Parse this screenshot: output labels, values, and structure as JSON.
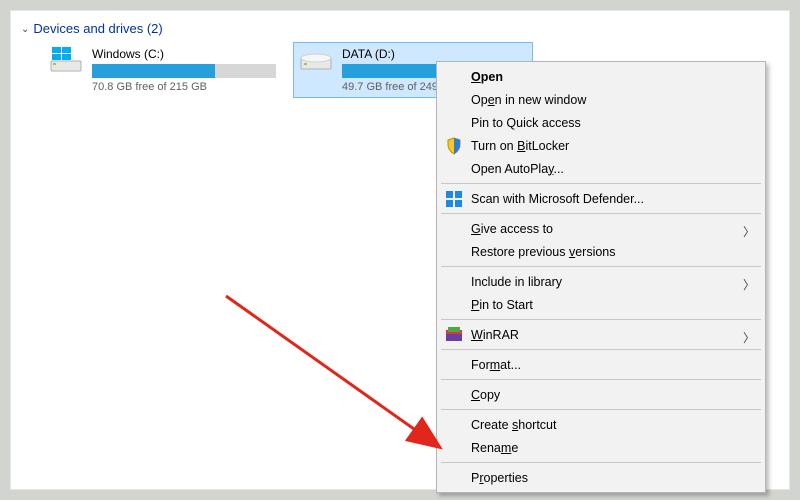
{
  "section": {
    "title": "Devices and drives (2)"
  },
  "drives": [
    {
      "name": "Windows (C:)",
      "free": "70.8 GB free of 215 GB",
      "fill_pct": 67
    },
    {
      "name": "DATA (D:)",
      "free": "49.7 GB free of 249",
      "fill_pct": 80
    }
  ],
  "context_separator_positions": [],
  "ctx": {
    "open": "Open",
    "open_new": "Open in new window",
    "pin_quick": "Pin to Quick access",
    "bitlocker": "Turn on BitLocker",
    "autoplay": "Open AutoPlay...",
    "defender": "Scan with Microsoft Defender...",
    "give_access": "Give access to",
    "restore": "Restore previous versions",
    "include_lib": "Include in library",
    "pin_start": "Pin to Start",
    "winrar": "WinRAR",
    "format": "Format...",
    "copy": "Copy",
    "shortcut": "Create shortcut",
    "rename": "Rename",
    "properties": "Properties"
  },
  "colors": {
    "accent": "#26a0da",
    "selection": "#cde8ff",
    "header_link": "#003399"
  }
}
